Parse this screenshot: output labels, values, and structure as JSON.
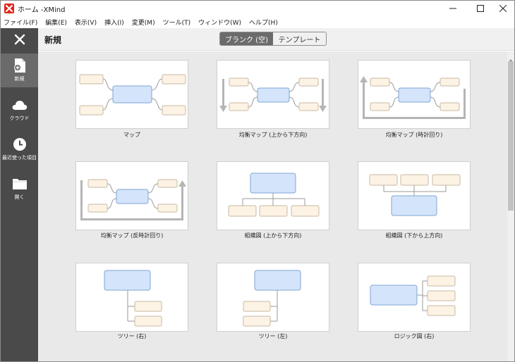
{
  "window": {
    "title": "ホーム -XMind"
  },
  "menu": [
    "ファイル(F)",
    "編集(E)",
    "表示(V)",
    "挿入(I)",
    "変更(M)",
    "ツール(T)",
    "ウィンドウ(W)",
    "ヘルプ(H)"
  ],
  "sidebar": {
    "items": [
      {
        "label": "新規",
        "icon": "new-file-icon",
        "active": true
      },
      {
        "label": "クラウド",
        "icon": "cloud-icon",
        "active": false
      },
      {
        "label": "最近使った項目",
        "icon": "clock-icon",
        "active": false
      },
      {
        "label": "開く",
        "icon": "folder-icon",
        "active": false
      }
    ]
  },
  "header": {
    "title": "新規",
    "tabs": [
      {
        "label": "ブランク (空)",
        "active": true
      },
      {
        "label": "テンプレート",
        "active": false
      }
    ]
  },
  "templates": [
    {
      "label": "マップ",
      "kind": "map"
    },
    {
      "label": "均衡マップ (上から下方向)",
      "kind": "balanced-down"
    },
    {
      "label": "均衡マップ (時計回り)",
      "kind": "balanced-cw"
    },
    {
      "label": "均衡マップ (反時計回り)",
      "kind": "balanced-ccw"
    },
    {
      "label": "組織図 (上から下方向)",
      "kind": "org-down"
    },
    {
      "label": "組織図 (下から上方向)",
      "kind": "org-up"
    },
    {
      "label": "ツリー (右)",
      "kind": "tree-right"
    },
    {
      "label": "ツリー (左)",
      "kind": "tree-left"
    },
    {
      "label": "ロジック図 (右)",
      "kind": "logic-right"
    }
  ],
  "colors": {
    "sidebar": "#4a4a4a",
    "central_topic": "#d4e4fb",
    "central_border": "#7fa6d6",
    "sub_topic": "#fdf3e4",
    "sub_border": "#c8b9a3",
    "brand": "#e2231a"
  }
}
